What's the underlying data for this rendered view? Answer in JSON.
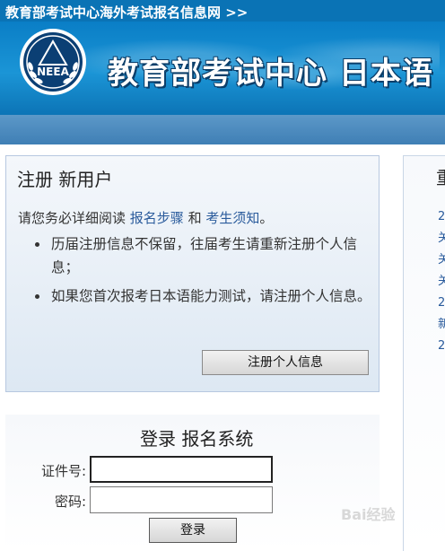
{
  "topbar": {
    "title": "教育部考试中心海外考试报名信息网 >>"
  },
  "banner": {
    "logo_text": "NEEA",
    "title": "教育部考试中心  日本语"
  },
  "register": {
    "title": "注册 新用户",
    "intro_prefix": "请您务必详细阅读 ",
    "intro_link1": "报名步骤",
    "intro_mid": " 和 ",
    "intro_link2": "考生须知",
    "intro_suffix": "。",
    "notes": [
      "历届注册信息不保留，往届考生请重新注册个人信息；",
      "如果您首次报考日本语能力测试，请注册个人信息。"
    ],
    "button_label": "注册个人信息"
  },
  "right_panel": {
    "title": "重",
    "links": [
      "2",
      "关",
      "关",
      "关",
      "2",
      "新",
      "2"
    ]
  },
  "login": {
    "title": "登录 报名系统",
    "id_label": "证件号:",
    "id_value": "",
    "password_label": "密码:",
    "password_value": "",
    "button_label": "登录"
  },
  "watermark": "Bai经验",
  "colors": {
    "brand_blue": "#0a73b5",
    "nav_blue": "#4a88bd",
    "link_blue": "#2a5b9c"
  }
}
